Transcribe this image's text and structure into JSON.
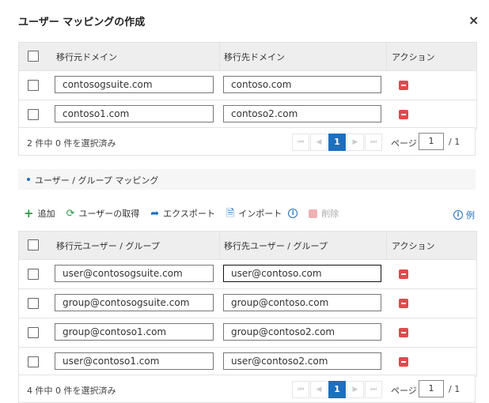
{
  "dialog": {
    "title": "ユーザー マッピングの作成",
    "close_glyph": "×"
  },
  "domain_table": {
    "headers": {
      "source": "移行元ドメイン",
      "target": "移行先ドメイン",
      "action": "アクション"
    },
    "rows": [
      {
        "source": "contosogsuite.com",
        "target": "contoso.com"
      },
      {
        "source": "contoso1.com",
        "target": "contoso2.com"
      }
    ],
    "footer": {
      "count": "2 件中 0 件を選択済み",
      "page_label": "ページ",
      "page_value": "1",
      "page_total": "/ 1",
      "current_page": "1"
    }
  },
  "section": {
    "label": "ユーザー / グループ マッピング"
  },
  "toolbar": {
    "add": "追加",
    "fetch": "ユーザーの取得",
    "export": "エクスポート",
    "import": "インポート",
    "delete": "削除",
    "example": "例"
  },
  "user_table": {
    "headers": {
      "source": "移行元ユーザー / グループ",
      "target": "移行先ユーザー / グループ",
      "action": "アクション"
    },
    "rows": [
      {
        "source": "user@contosogsuite.com",
        "target": "user@contoso.com"
      },
      {
        "source": "group@contosogsuite.com",
        "target": "group@contoso.com"
      },
      {
        "source": "group@contoso1.com",
        "target": "group@contoso2.com"
      },
      {
        "source": "user@contoso1.com",
        "target": "user@contoso2.com"
      }
    ],
    "footer": {
      "count": "4 件中 0 件を選択済み",
      "page_label": "ページ",
      "page_value": "1",
      "page_total": "/ 1",
      "current_page": "1"
    }
  },
  "pager_glyphs": {
    "first": "⏮",
    "prev": "◀",
    "next": "▶",
    "last": "⏭"
  },
  "colors": {
    "accent": "#1f6fbf",
    "delete": "#e0494d",
    "header_bg": "#eeeeee",
    "add_green": "#2e9b4a"
  },
  "icons": {
    "add": "plus-icon",
    "fetch": "refresh-icon",
    "export": "share-arrow-icon",
    "import": "file-import-icon",
    "delete": "minus-square-icon",
    "info": "info-icon"
  }
}
